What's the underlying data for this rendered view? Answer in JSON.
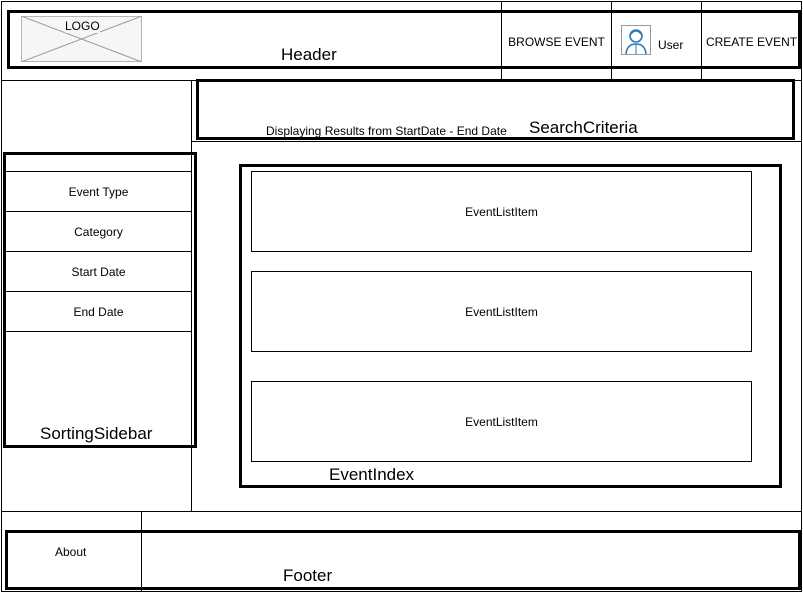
{
  "header": {
    "logo_label": "LOGO",
    "region_label": "Header",
    "browse_event": "BROWSE EVENT",
    "user_label": "User",
    "create_event": "CREATE EVENT"
  },
  "search": {
    "region_label": "SearchCriteria",
    "results_text": "Displaying Results from StartDate - End Date"
  },
  "sidebar": {
    "region_label": "SortingSidebar",
    "items": [
      {
        "label": "Event Type"
      },
      {
        "label": "Category"
      },
      {
        "label": "Start Date"
      },
      {
        "label": "End Date"
      }
    ]
  },
  "event_index": {
    "region_label": "EventIndex",
    "items": [
      {
        "label": "EventListItem"
      },
      {
        "label": "EventListItem"
      },
      {
        "label": "EventListItem"
      }
    ]
  },
  "footer": {
    "region_label": "Footer",
    "about": "About"
  }
}
